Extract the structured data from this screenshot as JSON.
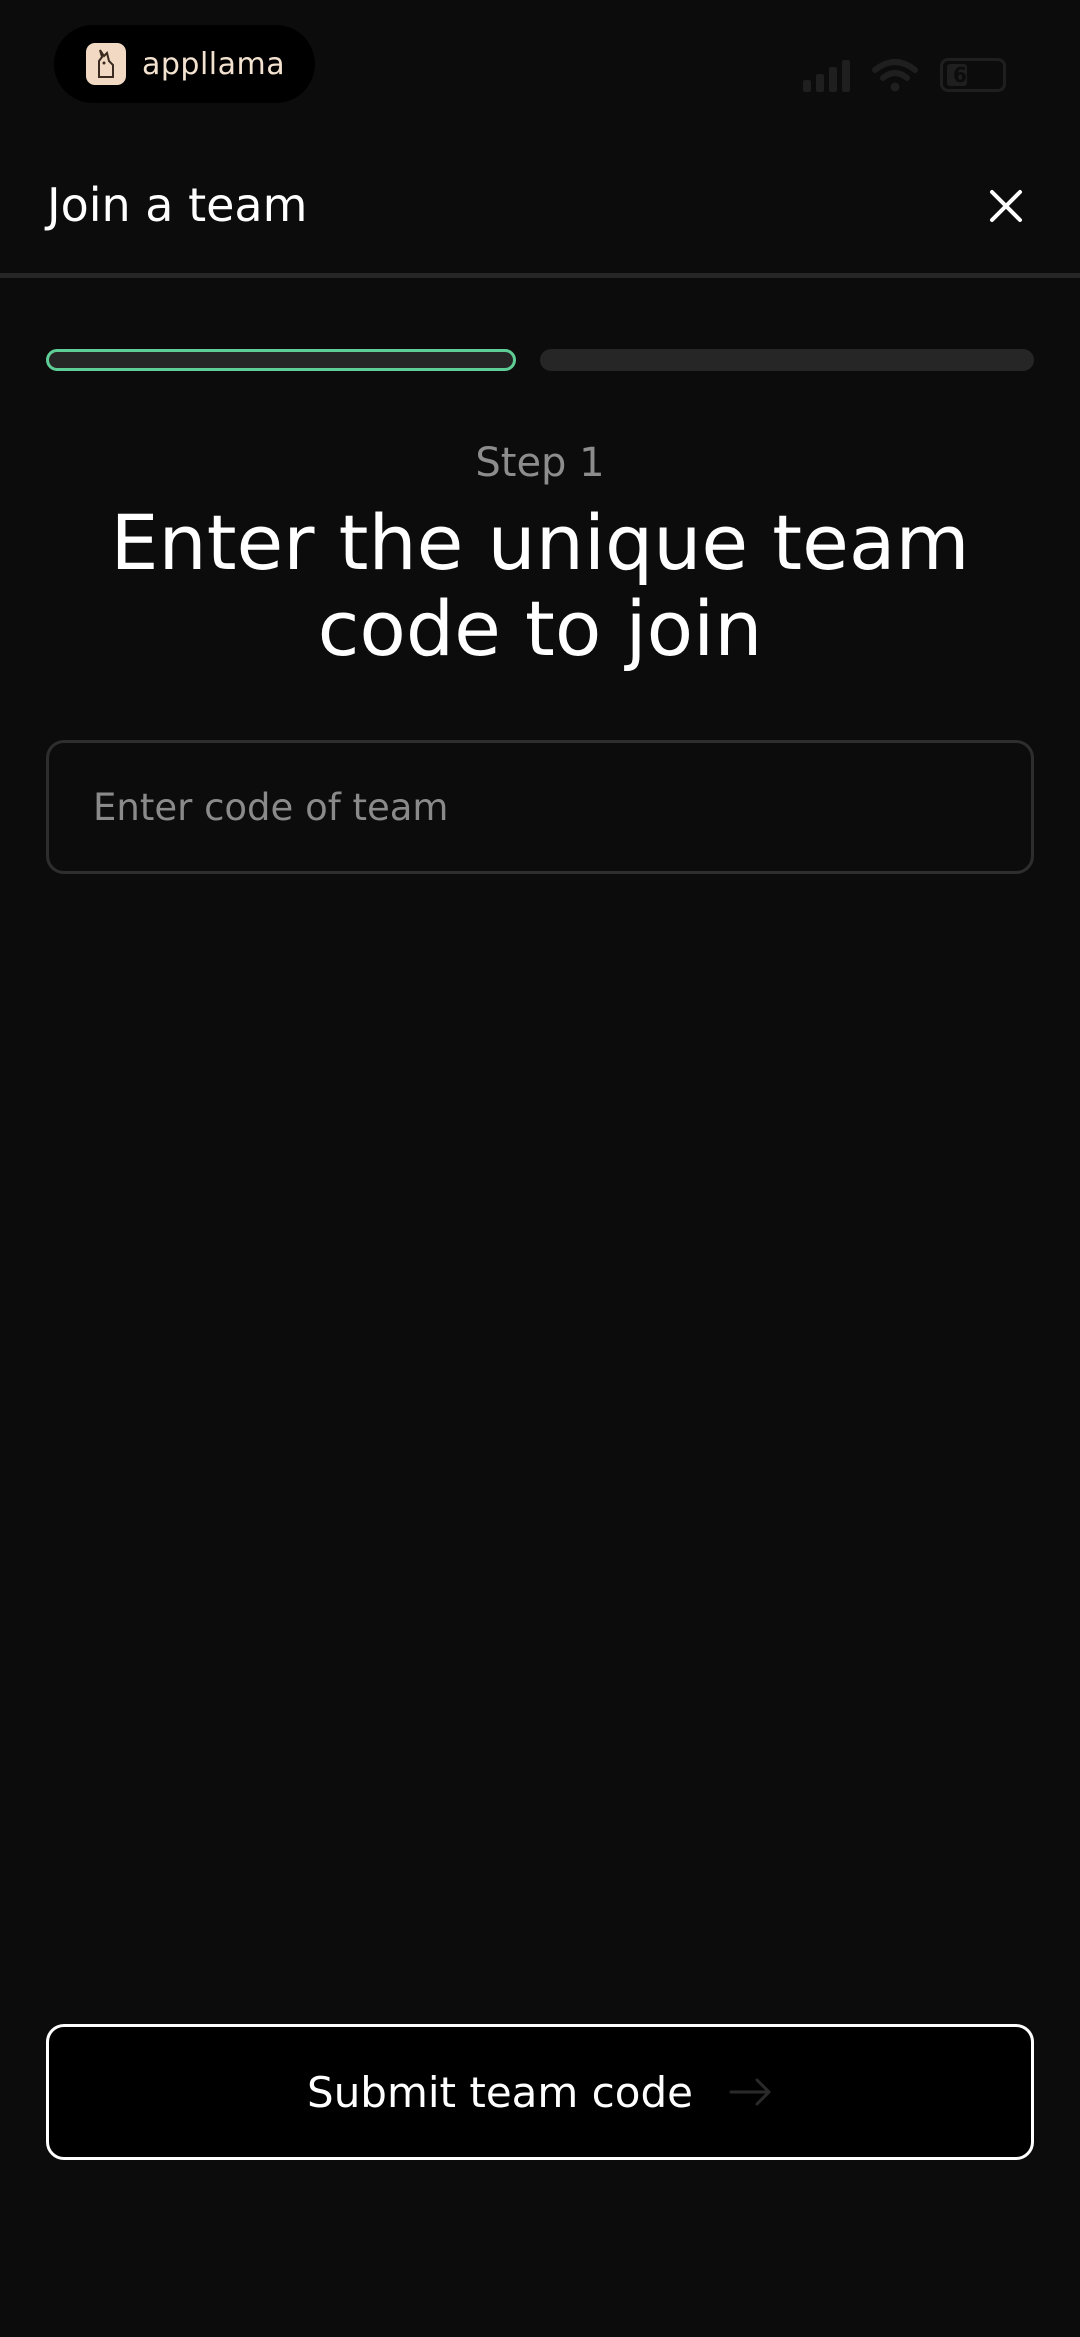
{
  "status_bar": {
    "brand_name": "appllama",
    "logo_icon": "llama-logo-icon",
    "signal_icon": "cellular-signal-icon",
    "wifi_icon": "wifi-icon",
    "battery_icon": "battery-icon",
    "battery_level": "6"
  },
  "header": {
    "title": "Join a team",
    "close_icon": "close-icon"
  },
  "progress": {
    "total_steps": 2,
    "current_step": 1,
    "active_color": "#5fce96",
    "inactive_color": "#262626"
  },
  "step": {
    "label": "Step 1",
    "title": "Enter the unique team code to join"
  },
  "code_input": {
    "placeholder": "Enter code of team",
    "value": ""
  },
  "submit": {
    "label": "Submit team code",
    "icon": "arrow-right-icon"
  }
}
